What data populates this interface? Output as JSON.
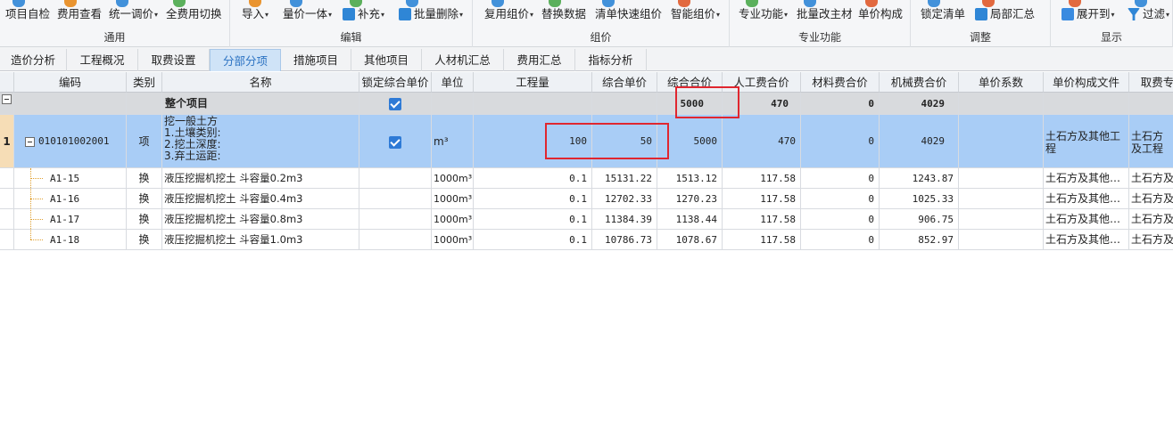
{
  "ribbon": {
    "groups": [
      {
        "label": "通用",
        "items": [
          {
            "label": "项目自检",
            "icon": "check-icon",
            "dd": false
          },
          {
            "label": "费用查看",
            "icon": "view-icon",
            "dd": false
          },
          {
            "label": "统一调价",
            "icon": "price-icon",
            "dd": true
          },
          {
            "label": "全费用切换",
            "icon": "switch-icon",
            "dd": false
          }
        ]
      },
      {
        "label": "编辑",
        "items": [
          {
            "label": "导入",
            "icon": "import-icon",
            "dd": true
          },
          {
            "label": "量价一体",
            "icon": "qty-price-icon",
            "dd": true
          },
          {
            "label": "补充",
            "icon": "supplement-icon",
            "dd": true
          },
          {
            "label": "批量删除",
            "icon": "batch-delete-icon",
            "dd": true
          }
        ]
      },
      {
        "label": "组价",
        "items": [
          {
            "label": "复用组价",
            "icon": "reuse-icon",
            "dd": true
          },
          {
            "label": "替换数据",
            "icon": "replace-icon",
            "dd": false
          },
          {
            "label": "清单快速组价",
            "icon": "quick-price-icon",
            "dd": false
          },
          {
            "label": "智能组价",
            "icon": "smart-price-icon",
            "dd": true
          }
        ]
      },
      {
        "label": "专业功能",
        "items": [
          {
            "label": "专业功能",
            "icon": "pro-icon",
            "dd": true
          },
          {
            "label": "批量改主材",
            "icon": "material-icon",
            "dd": false
          },
          {
            "label": "单价构成",
            "icon": "unit-price-icon",
            "dd": false
          }
        ]
      },
      {
        "label": "调整",
        "items": [
          {
            "label": "锁定清单",
            "icon": "lock-icon",
            "dd": false
          },
          {
            "label": "局部汇总",
            "icon": "partial-sum-icon",
            "dd": false
          }
        ]
      },
      {
        "label": "显示",
        "items": [
          {
            "label": "展开到",
            "icon": "expand-icon",
            "dd": true
          },
          {
            "label": "过滤",
            "icon": "filter-icon",
            "dd": true
          }
        ]
      }
    ]
  },
  "tabs": [
    {
      "label": "造价分析",
      "active": false
    },
    {
      "label": "工程概况",
      "active": false
    },
    {
      "label": "取费设置",
      "active": false
    },
    {
      "label": "分部分项",
      "active": true
    },
    {
      "label": "措施项目",
      "active": false
    },
    {
      "label": "其他项目",
      "active": false
    },
    {
      "label": "人材机汇总",
      "active": false
    },
    {
      "label": "费用汇总",
      "active": false
    },
    {
      "label": "指标分析",
      "active": false
    }
  ],
  "table": {
    "headers": [
      "编码",
      "类别",
      "名称",
      "锁定综合单价",
      "单位",
      "工程量",
      "综合单价",
      "综合合价",
      "人工费合价",
      "材料费合价",
      "机械费合价",
      "单价系数",
      "单价构成文件",
      "取费专"
    ],
    "total_row": {
      "name": "整个项目",
      "locked": true,
      "total_price": "5000",
      "labor": "470",
      "material": "0",
      "machine": "4029"
    },
    "item_row": {
      "index": "1",
      "code": "010101002001",
      "category": "项",
      "name_lines": [
        "挖一般土方",
        "1.土壤类别:",
        "2.挖土深度:",
        "3.弃土运距:"
      ],
      "locked": true,
      "unit": "m³",
      "quantity": "100",
      "unit_price": "50",
      "total_price": "5000",
      "labor": "470",
      "material": "0",
      "machine": "4029",
      "price_file": "土石方及其他工程",
      "fee_major": "土石方及工程"
    },
    "sub_rows": [
      {
        "code": "A1-15",
        "category": "换",
        "name": "液压挖掘机挖土 斗容量0.2m3",
        "unit": "1000m³",
        "quantity": "0.1",
        "unit_price": "15131.22",
        "total_price": "1513.12",
        "labor": "117.58",
        "material": "0",
        "machine": "1243.87",
        "price_file": "土石方及其他…",
        "fee_major": "土石方及"
      },
      {
        "code": "A1-16",
        "category": "换",
        "name": "液压挖掘机挖土 斗容量0.4m3",
        "unit": "1000m³",
        "quantity": "0.1",
        "unit_price": "12702.33",
        "total_price": "1270.23",
        "labor": "117.58",
        "material": "0",
        "machine": "1025.33",
        "price_file": "土石方及其他…",
        "fee_major": "土石方及"
      },
      {
        "code": "A1-17",
        "category": "换",
        "name": "液压挖掘机挖土 斗容量0.8m3",
        "unit": "1000m³",
        "quantity": "0.1",
        "unit_price": "11384.39",
        "total_price": "1138.44",
        "labor": "117.58",
        "material": "0",
        "machine": "906.75",
        "price_file": "土石方及其他…",
        "fee_major": "土石方及"
      },
      {
        "code": "A1-18",
        "category": "换",
        "name": "液压挖掘机挖土 斗容量1.0m3",
        "unit": "1000m³",
        "quantity": "0.1",
        "unit_price": "10786.73",
        "total_price": "1078.67",
        "labor": "117.58",
        "material": "0",
        "machine": "852.97",
        "price_file": "土石方及其他…",
        "fee_major": "土石方及"
      }
    ]
  },
  "colors": {
    "accent": "#2e7ad6",
    "highlight_row": "#a9cdf6",
    "total_row": "#d8dadd",
    "annotation_box": "#e0262f"
  }
}
